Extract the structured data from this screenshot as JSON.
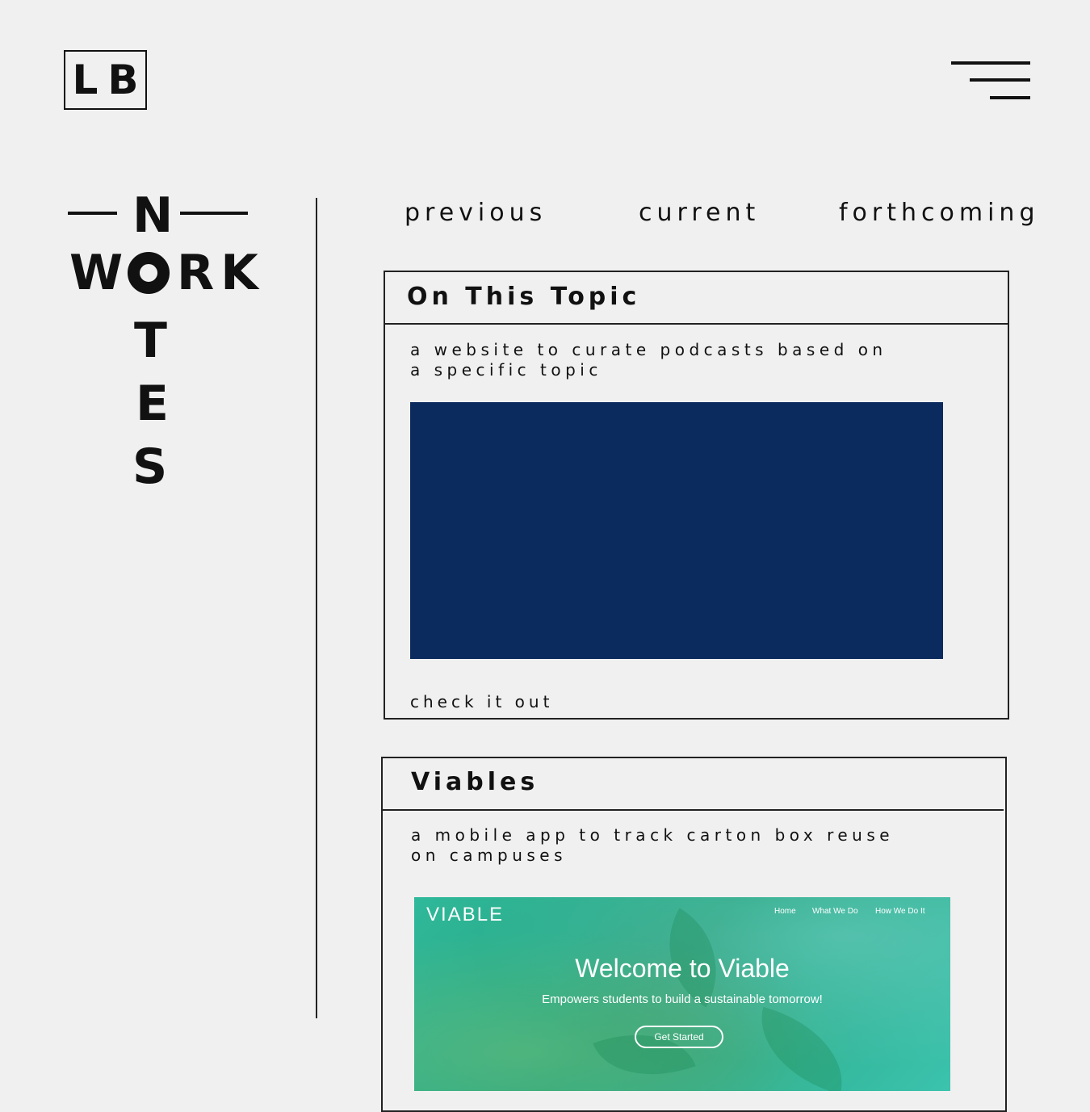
{
  "logo": {
    "text": "LB"
  },
  "menu": {
    "icon": "hamburger-menu-icon"
  },
  "wordmark": {
    "n": "N",
    "w": "W",
    "rk": "RK",
    "t": "T",
    "e": "E",
    "s": "S"
  },
  "nav": {
    "previous": "previous",
    "current": "current",
    "forthcoming": "forthcoming"
  },
  "projects": [
    {
      "title": "On This Topic",
      "description": "a website to curate podcasts based on a specific topic",
      "link_label": "check it out",
      "thumb_color": "#0b2b5e"
    },
    {
      "title": "Viables",
      "description": "a mobile app to track carton box reuse on campuses",
      "screenshot": {
        "brand": "VIABLE",
        "nav": [
          "Home",
          "What We Do",
          "How We Do It"
        ],
        "headline": "Welcome to Viable",
        "subheadline": "Empowers students to build a sustainable tomorrow!",
        "button": "Get Started"
      }
    }
  ]
}
